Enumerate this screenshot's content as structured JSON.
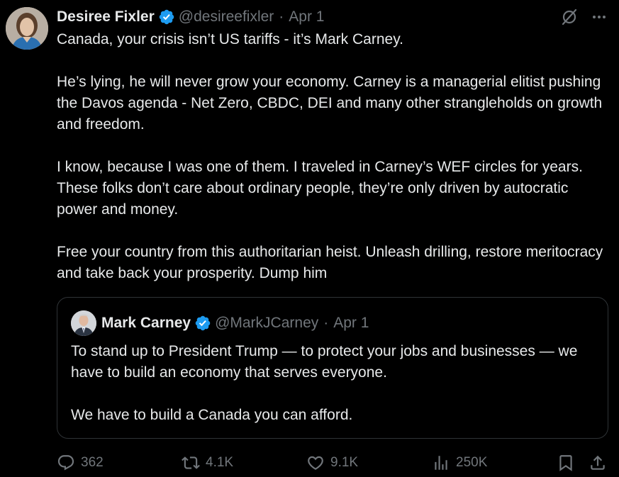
{
  "author": {
    "name": "Desiree Fixler",
    "handle": "@desireefixler",
    "separator": "·",
    "date": "Apr 1"
  },
  "body": {
    "p1": "Canada, your crisis isn’t US tariffs - it’s Mark Carney.",
    "p2": "He’s lying, he will never grow your economy. Carney is a managerial elitist pushing the Davos agenda - Net Zero, CBDC, DEI and many other strangleholds on growth and freedom.",
    "p3": "I know, because I was one of them.  I traveled in Carney’s WEF circles for years.  These folks don’t care about ordinary people, they’re only driven by autocratic power and money.",
    "p4": "Free your country from this authoritarian heist. Unleash drilling, restore meritocracy and take back your prosperity.  Dump him"
  },
  "quote": {
    "name": "Mark Carney",
    "handle": "@MarkJCarney",
    "separator": "·",
    "date": "Apr 1",
    "p1": "To stand up to President Trump — to protect your jobs and businesses — we have to build an economy that serves everyone.",
    "p2": "We have to build a Canada you can afford."
  },
  "actions": {
    "replies": "362",
    "reposts": "4.1K",
    "likes": "9.1K",
    "views": "250K"
  },
  "icons": {
    "verified": "verified-badge-icon",
    "grok": "grok-icon",
    "more": "more-icon",
    "reply": "reply-icon",
    "repost": "repost-icon",
    "like": "heart-icon",
    "views": "views-icon",
    "bookmark": "bookmark-icon",
    "share": "share-icon"
  },
  "colors": {
    "background": "#000000",
    "text": "#e7e9ea",
    "muted": "#71767b",
    "verified": "#1d9bf0",
    "border": "#2f3336"
  }
}
